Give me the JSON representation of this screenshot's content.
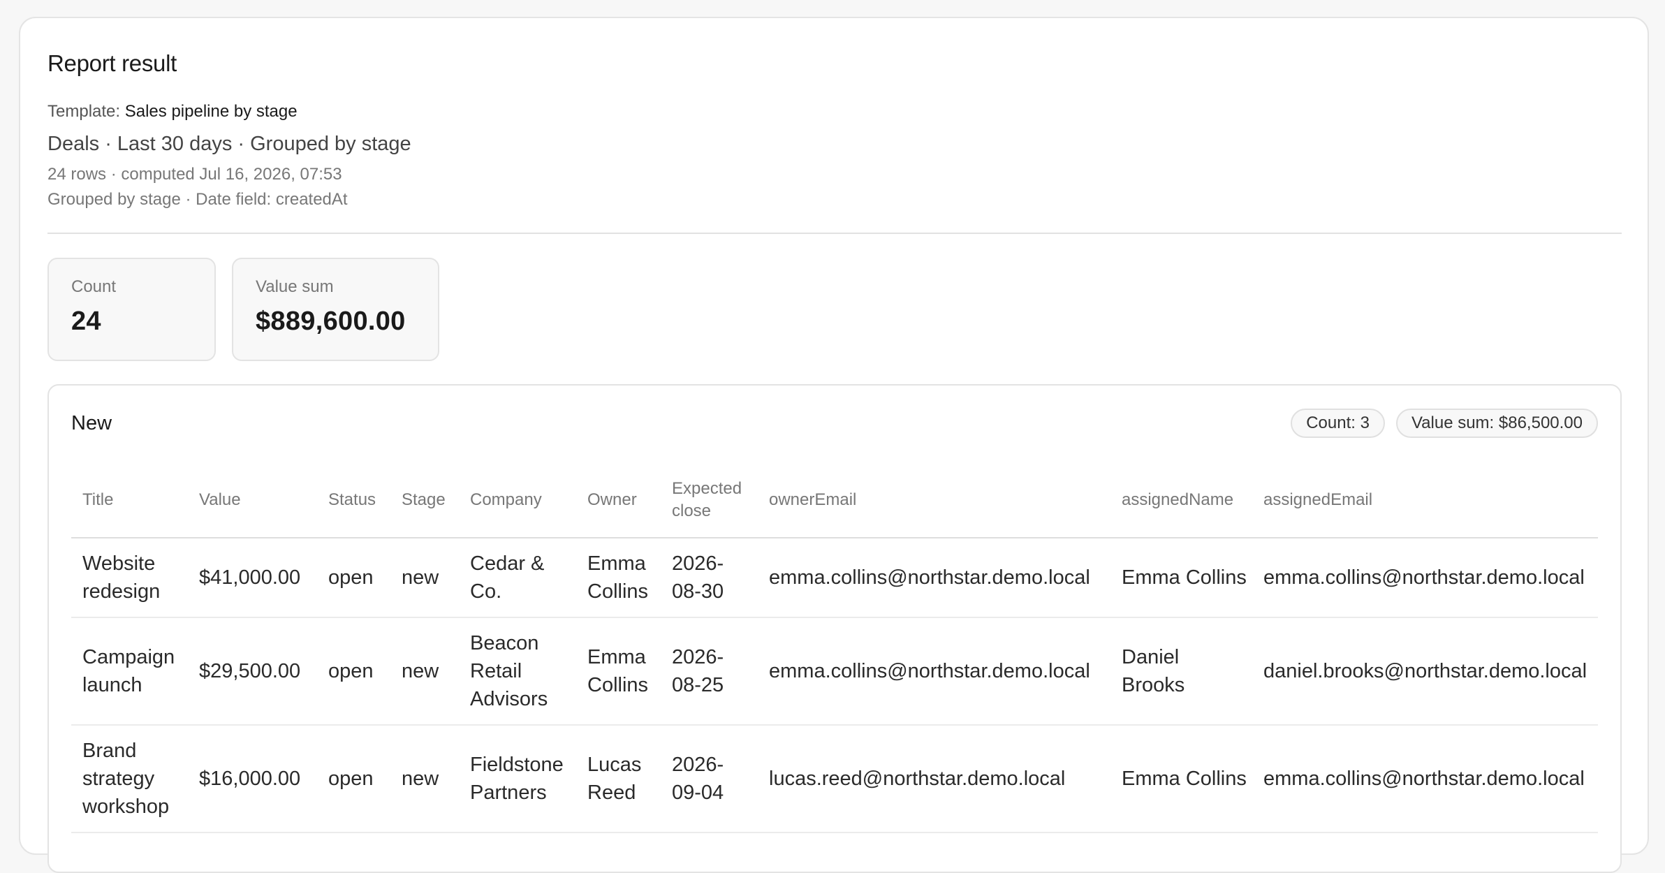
{
  "report": {
    "title": "Report result",
    "template_label": "Template:",
    "template_value": "Sales pipeline by stage",
    "summary": "Deals · Last 30 days · Grouped by stage",
    "rows_info": "24 rows · computed Jul 16, 2026, 07:53",
    "group_info": "Grouped by stage · Date field: createdAt"
  },
  "stats": {
    "count_label": "Count",
    "count_value": "24",
    "sum_label": "Value sum",
    "sum_value": "$889,600.00"
  },
  "group": {
    "title": "New",
    "count_chip": "Count: 3",
    "sum_chip": "Value sum: $86,500.00",
    "columns": [
      "Title",
      "Value",
      "Status",
      "Stage",
      "Company",
      "Owner",
      "Expected close",
      "ownerEmail",
      "assignedName",
      "assignedEmail"
    ],
    "rows": [
      [
        "Website redesign",
        "$41,000.00",
        "open",
        "new",
        "Cedar & Co.",
        "Emma Collins",
        "2026-08-30",
        "emma.collins@northstar.demo.local",
        "Emma Collins",
        "emma.collins@northstar.demo.local"
      ],
      [
        "Campaign launch",
        "$29,500.00",
        "open",
        "new",
        "Beacon Retail Advisors",
        "Emma Collins",
        "2026-08-25",
        "emma.collins@northstar.demo.local",
        "Daniel Brooks",
        "daniel.brooks@northstar.demo.local"
      ],
      [
        "Brand strategy workshop",
        "$16,000.00",
        "open",
        "new",
        "Fieldstone Partners",
        "Lucas Reed",
        "2026-09-04",
        "lucas.reed@northstar.demo.local",
        "Emma Collins",
        "emma.collins@northstar.demo.local"
      ]
    ]
  }
}
